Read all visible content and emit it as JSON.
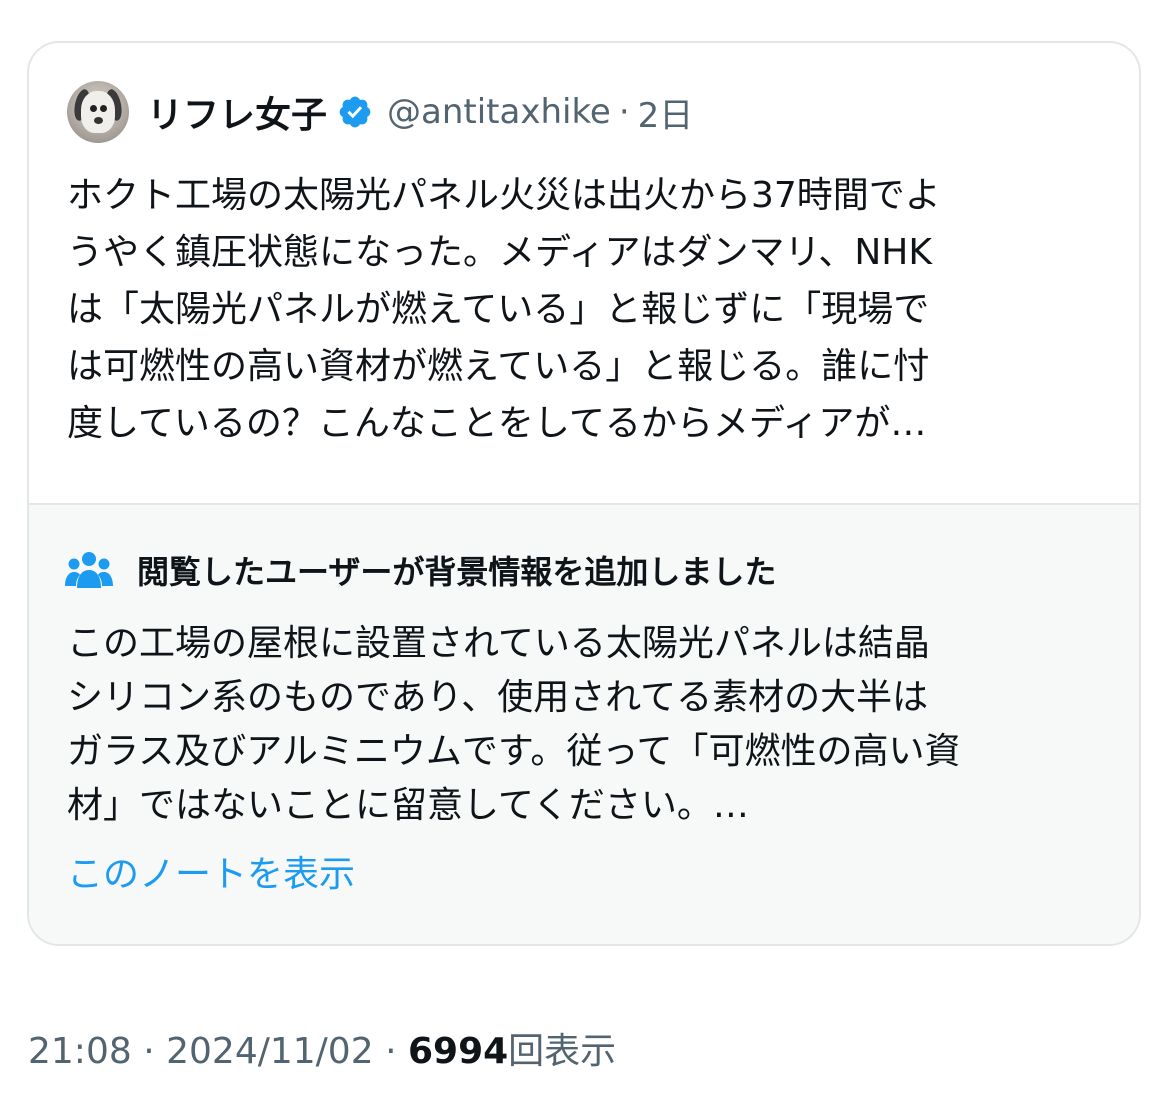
{
  "quoted_tweet": {
    "display_name": "リフレ女子",
    "handle": "@antitaxhike",
    "separator": "·",
    "time_ago": "2日",
    "text_lines": [
      "ホクト工場の太陽光パネル火災は出火から37時間でよ",
      "うやく鎮圧状態になった。メディアはダンマリ、NHK",
      "は「太陽光パネルが燃えている」と報じずに「現場で",
      "は可燃性の高い資材が燃えている」と報じる。誰に忖",
      "度しているの？こんなことをしてるからメディアが…"
    ],
    "icons": {
      "avatar": "avatar-dog-image",
      "verified": "verified-badge-icon"
    }
  },
  "community_note": {
    "title": "閲覧したユーザーが背景情報を追加しました",
    "icon": "people-icon",
    "text_lines": [
      "この工場の屋根に設置されている太陽光パネルは結晶",
      "シリコン系のものであり、使用されてる素材の大半は",
      "ガラス及びアルミニウムです。従って「可燃性の高い資",
      "材」ではないことに留意してください。…"
    ],
    "link_label": "このノートを表示"
  },
  "meta": {
    "time": "21:08",
    "separator": "·",
    "date": "2024/11/02",
    "views_count": "6994",
    "views_label": "回表示"
  },
  "colors": {
    "text_primary": "#0f1419",
    "text_secondary": "#536471",
    "link_blue": "#1d9bf0",
    "verified_blue": "#1d9bf0",
    "note_background": "#f7f9f9",
    "border": "#e3e6e8"
  }
}
